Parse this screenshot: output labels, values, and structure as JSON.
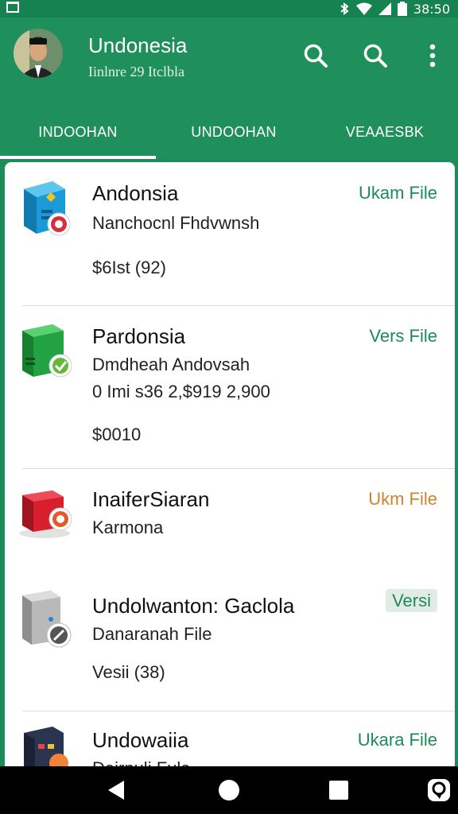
{
  "status_bar": {
    "time": "38:50",
    "icons": [
      "gallery-icon",
      "bluetooth-icon",
      "wifi-icon",
      "signal-icon",
      "battery-icon"
    ]
  },
  "app_bar": {
    "title": "Undonesia",
    "subtitle": "Iinlnre 29 Itclbla",
    "actions": [
      "search-icon",
      "search-icon",
      "more-vert-icon"
    ]
  },
  "tabs": [
    {
      "label": "INDOOHAN",
      "active": true
    },
    {
      "label": "UNDOOHAN",
      "active": false
    },
    {
      "label": "VEAAESBK",
      "active": false
    }
  ],
  "items": [
    {
      "title": "Andonsia",
      "line1": "Nanchocnl Fhdvwnsh",
      "line2": "",
      "line3": "$6Ist (92)",
      "action": "Ukam File",
      "icon": "blue-box-app-icon"
    },
    {
      "title": "Pardonsia",
      "line1": "Dmdheah Andovsah",
      "line2": "0 Imi s36 2,$919 2,900",
      "line3": "$0010",
      "action": "Vers File",
      "icon": "green-box-app-icon"
    },
    {
      "title": "InaiferSiaran",
      "line1": "Karmona",
      "line2": "",
      "line3": "",
      "action": "Ukm File",
      "icon": "red-box-app-icon"
    },
    {
      "title": "Undolwanton: Gaclola",
      "line1": "Danaranah File",
      "line2": "",
      "line3": "Vesii (38)",
      "action": "Versi",
      "icon": "gray-device-app-icon"
    },
    {
      "title": "Undowaiia",
      "line1": "Dairnuli Fula",
      "line2": "",
      "line3": "",
      "action": "Ukara File",
      "icon": "dark-box-app-icon"
    }
  ],
  "colors": {
    "primary": "#1f8f5b",
    "status_bar": "#15824f",
    "accent_green": "#1d8a5a",
    "accent_orange": "#cc8430"
  },
  "nav_bar": [
    "back-icon",
    "home-icon",
    "recents-icon",
    "assistant-icon"
  ]
}
